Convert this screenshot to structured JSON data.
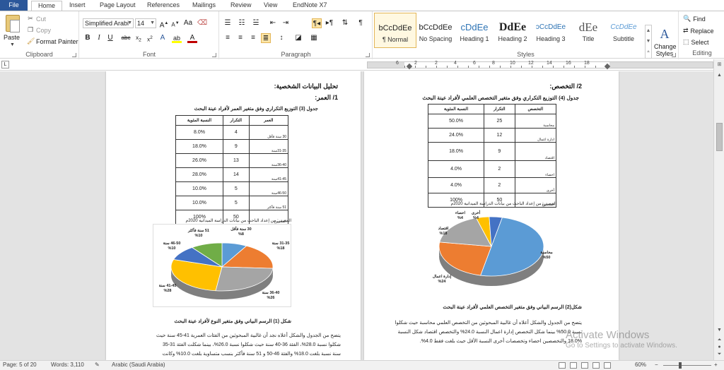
{
  "menu": {
    "tabs": [
      "File",
      "Home",
      "Insert",
      "Page Layout",
      "References",
      "Mailings",
      "Review",
      "View",
      "EndNote X7"
    ],
    "active": "Home"
  },
  "clipboard": {
    "paste": "Paste",
    "cut": "Cut",
    "copy": "Copy",
    "format_painter": "Format Painter",
    "group": "Clipboard"
  },
  "font": {
    "name": "Simplified Arabi",
    "size": "14",
    "group": "Font"
  },
  "paragraph": {
    "group": "Paragraph"
  },
  "styles": {
    "group": "Styles",
    "items": [
      {
        "preview": "bCcDdEe",
        "name": "¶ Normal"
      },
      {
        "preview": "bCcDdEe",
        "name": "No Spacing"
      },
      {
        "preview": "cDdEe",
        "name": "Heading 1"
      },
      {
        "preview": "DdEe",
        "name": "Heading 2"
      },
      {
        "preview": "ɔCcDdEe",
        "name": "Heading 3"
      },
      {
        "preview": "dEe",
        "name": "Title"
      },
      {
        "preview": "CcDdEe",
        "name": "Subtitle"
      }
    ],
    "change_styles": "Change Styles"
  },
  "editing": {
    "group": "Editing",
    "find": "Find",
    "replace": "Replace",
    "select": "Select"
  },
  "ruler": {
    "numbers": [
      "6",
      "2",
      "2",
      "4",
      "6",
      "8",
      "10",
      "12",
      "14",
      "16",
      "18"
    ]
  },
  "left_page": {
    "heading1": "تحليل البيانات الشخصية:",
    "heading2": "1/ العمر:",
    "table_caption": "جدول (3) التوزيع التكراري وفق متغير العمر لأفراد عينة البحث",
    "headers": [
      "العمر",
      "التكرار",
      "النسبة المئوية"
    ],
    "rows": [
      {
        "label": "30 سنة فأقل",
        "count": "4",
        "pct": "8.0%"
      },
      {
        "label": "31-35سنة",
        "count": "9",
        "pct": "18.0%"
      },
      {
        "label": "36-40سنة",
        "count": "13",
        "pct": "26.0%"
      },
      {
        "label": "41-45سنة",
        "count": "14",
        "pct": "28.0%"
      },
      {
        "label": "46-50سنة",
        "count": "5",
        "pct": "10.0%"
      },
      {
        "label": "51 سنة فأكثر",
        "count": "5",
        "pct": "10.0%"
      },
      {
        "label": "المجموع",
        "count": "50",
        "pct": "100%"
      }
    ],
    "source": "المصدر: من إعداد الباحث من بيانات الدراسة الميدانية 2020م",
    "figure_caption": "شكل (1) الرسم البياني وفق متغير النوع لأفراد عينة البحث",
    "paragraph": [
      "يتضح من الجدول والشكل أعلاه نجد أن غالبية المبحوثين من الفئات العمرية 41-45 سنة حيث",
      "شكلوا نسبة 28.0%، الفئة 36-40 سنة حيث شكلوا نسبة 26.0%، بينما شكلت الفئة 31-35",
      "سنة نسبة بلغت 18.0% والفئة 46-50 و 51 سنة فأكثر بنسب متساوية بلغت 10.0% وكانت"
    ]
  },
  "right_page": {
    "heading": "2/ التخصص:",
    "table_caption": "جدول (4) التوزيع التكراري وفق متغير التخصص العلمي لأفراد عينة البحث",
    "headers": [
      "التخصص",
      "التكرار",
      "النسبة المئوية"
    ],
    "rows": [
      {
        "label": "محاسبة",
        "count": "25",
        "pct": "50.0%"
      },
      {
        "label": "ادارة اعمال",
        "count": "12",
        "pct": "24.0%"
      },
      {
        "label": "اقتصاد",
        "count": "9",
        "pct": "18.0%"
      },
      {
        "label": "احصاء",
        "count": "2",
        "pct": "4.0%"
      },
      {
        "label": "أخرى",
        "count": "2",
        "pct": "4.0%"
      },
      {
        "label": "المجموع",
        "count": "50",
        "pct": "100%"
      }
    ],
    "source": "المصدر: من إعداد الباحث من بيانات الدراسة الميدانية 2020م",
    "figure_caption": "شكل(2) الرسم البياني وفق متغير التخصص العلمي لأفراد عينة البحث",
    "paragraph": [
      "يتضح من الجدول والشكل أعلاه أن غالبية المبحوثين من التخصص العلمي محاسبة حيث شكلوا",
      "نسبة 50.0% بينما شكل التخصص إدارة اعمال النسبة 24.0% والتخصص اقتصاد شكل النسبة",
      "18.0% والتخصصين احصاء وتخصصات أخرى النسبة الأقل حيث بلغت فقط 4.0%."
    ]
  },
  "chart_data": [
    {
      "type": "pie",
      "series": [
        {
          "label": "30 سنة فأقل",
          "pct_label": "%8",
          "value": 8,
          "color": "#5b9bd5"
        },
        {
          "label": "31-35 سنة",
          "pct_label": "%18",
          "value": 18,
          "color": "#ed7d31"
        },
        {
          "label": "36-40 سنة",
          "pct_label": "%26",
          "value": 26,
          "color": "#a5a5a5"
        },
        {
          "label": "41-45 سنة",
          "pct_label": "%28",
          "value": 28,
          "color": "#ffc000"
        },
        {
          "label": "46-50 سنة",
          "pct_label": "%10",
          "value": 10,
          "color": "#4472c4"
        },
        {
          "label": "51 سنة فأكثر",
          "pct_label": "%10",
          "value": 10,
          "color": "#70ad47"
        }
      ]
    },
    {
      "type": "pie",
      "series": [
        {
          "label": "محاسبة",
          "pct_label": "%50",
          "value": 50,
          "color": "#5b9bd5"
        },
        {
          "label": "إدارة اعمال",
          "pct_label": "%24",
          "value": 24,
          "color": "#ed7d31"
        },
        {
          "label": "اقتصاد",
          "pct_label": "%18",
          "value": 18,
          "color": "#a5a5a5"
        },
        {
          "label": "احصاء",
          "pct_label": "%4",
          "value": 4,
          "color": "#ffc000"
        },
        {
          "label": "أخرى",
          "pct_label": "%4",
          "value": 4,
          "color": "#4472c4"
        }
      ]
    }
  ],
  "status": {
    "page": "Page: 5 of 20",
    "words": "Words: 3,110",
    "language": "Arabic (Saudi Arabia)",
    "zoom": "60%"
  },
  "watermark": {
    "title": "Activate Windows",
    "subtitle": "Go to Settings to activate Windows."
  }
}
